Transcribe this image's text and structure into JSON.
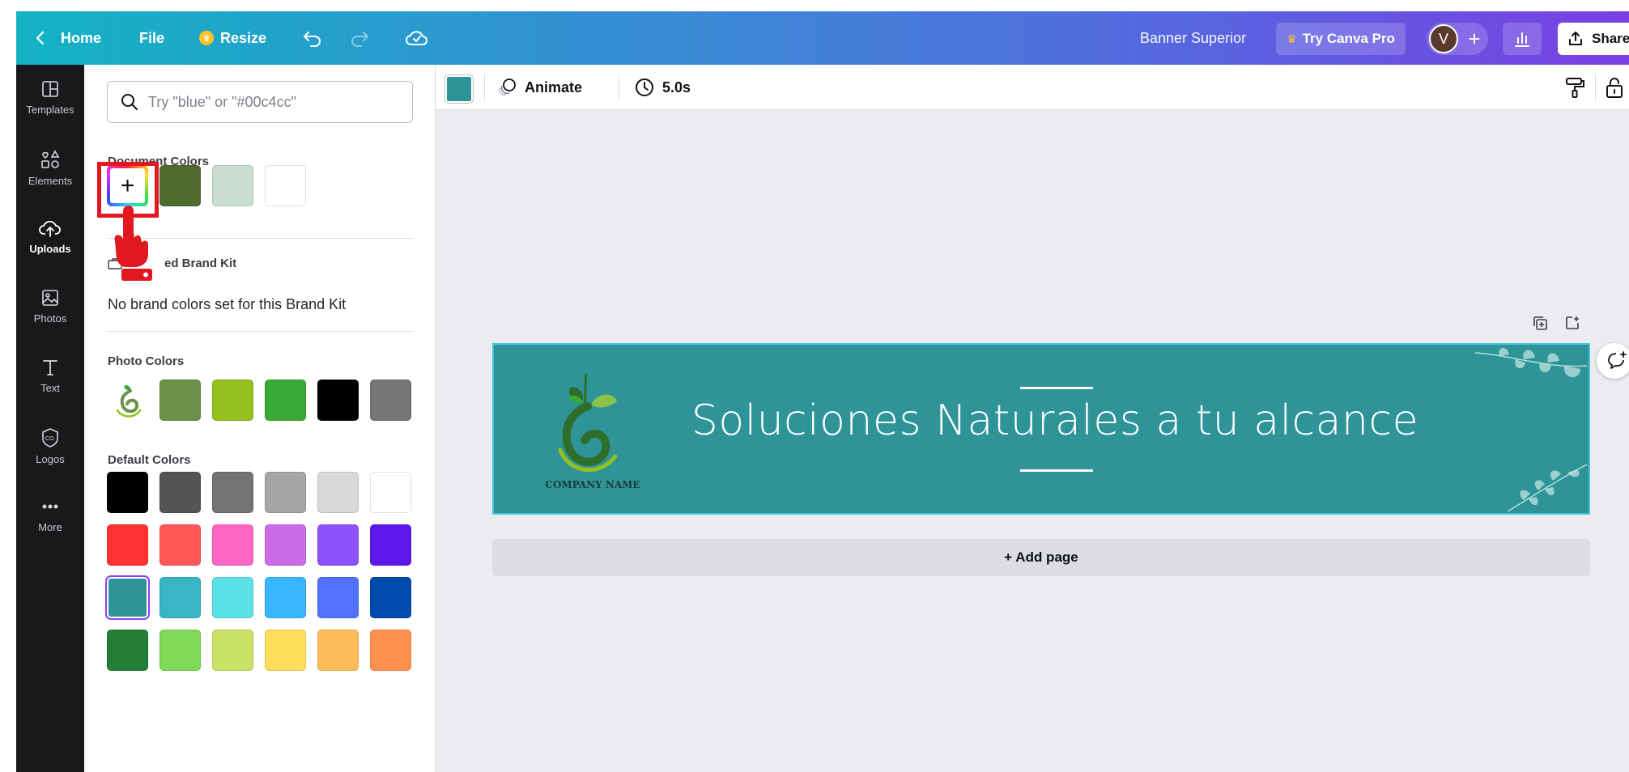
{
  "topbar": {
    "home_label": "Home",
    "file_label": "File",
    "resize_label": "Resize",
    "doc_title": "Banner Superior",
    "try_pro_label": "Try Canva Pro",
    "avatar_initial": "V",
    "share_label": "Share"
  },
  "rail": {
    "items": [
      {
        "label": "Templates",
        "icon": "templates-icon"
      },
      {
        "label": "Elements",
        "icon": "elements-icon"
      },
      {
        "label": "Uploads",
        "icon": "upload-cloud-icon",
        "active": true
      },
      {
        "label": "Photos",
        "icon": "photo-icon"
      },
      {
        "label": "Text",
        "icon": "text-icon"
      },
      {
        "label": "Logos",
        "icon": "logo-icon"
      },
      {
        "label": "More",
        "icon": "more-dots-icon"
      }
    ]
  },
  "panel": {
    "search_placeholder": "Try \"blue\" or \"#00c4cc\"",
    "document_colors_title": "Document Colors",
    "document_colors": [
      "#4f6b2e",
      "#c8ddd0",
      "#ffffff"
    ],
    "brand_kit_title": "ed Brand Kit",
    "brand_kit_empty": "No brand colors set for this Brand Kit",
    "photo_colors_title": "Photo Colors",
    "photo_colors": [
      "#6a9148",
      "#95c11f",
      "#3aaa35",
      "#000000",
      "#767676"
    ],
    "default_colors_title": "Default Colors",
    "default_colors": [
      [
        "#000000",
        "#545454",
        "#737373",
        "#a6a6a6",
        "#d9d9d9",
        "#ffffff"
      ],
      [
        "#ff3131",
        "#ff5757",
        "#ff66c4",
        "#cb6ce6",
        "#8c52ff",
        "#5e17eb"
      ],
      [
        "#2e9498",
        "#38b6c4",
        "#5ce1e6",
        "#38b6ff",
        "#5271ff",
        "#004aad"
      ],
      [
        "#237f37",
        "#7ed957",
        "#c9e265",
        "#ffde59",
        "#ffbd59",
        "#ff914d"
      ]
    ],
    "selected_color": "#2e9498"
  },
  "ctx": {
    "current_color": "#2e9498",
    "animate_label": "Animate",
    "duration_label": "5.0s"
  },
  "canvas": {
    "banner_bg": "#2e9498",
    "banner_title": "Soluciones Naturales a tu alcance",
    "company_name": "COMPANY NAME",
    "add_page_label": "+ Add page"
  }
}
